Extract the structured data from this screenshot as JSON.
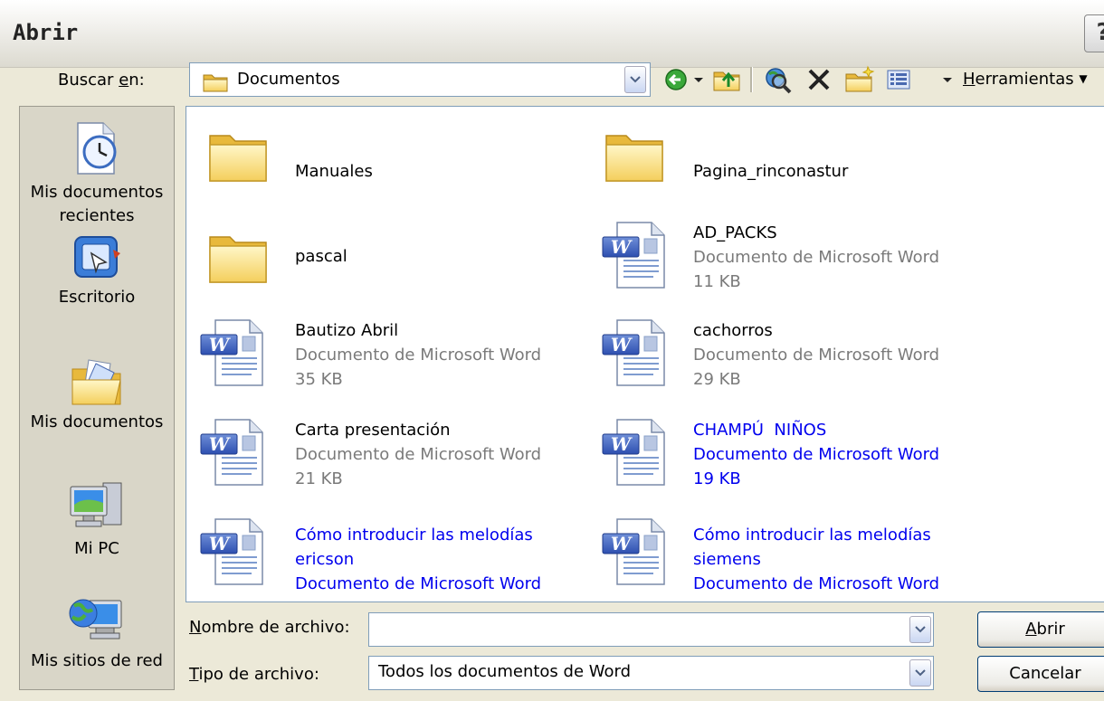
{
  "window": {
    "title": "Abrir",
    "help_glyph": "?"
  },
  "toolbar": {
    "lookin_label": "Buscar en:",
    "lookin_label_accel": "e",
    "lookin_value": "Documentos",
    "tools_label": "Herramientas"
  },
  "places": [
    {
      "label": "Mis documentos recientes",
      "icon": "recent-docs-icon"
    },
    {
      "label": "Escritorio",
      "icon": "desktop-icon"
    },
    {
      "label": "Mis documentos",
      "icon": "my-documents-icon"
    },
    {
      "label": "Mi PC",
      "icon": "my-computer-icon"
    },
    {
      "label": "Mis sitios de red",
      "icon": "network-places-icon"
    }
  ],
  "files": [
    {
      "name": "Manuales",
      "type": "",
      "size": "",
      "icon": "folder-icon",
      "selected": false
    },
    {
      "name": "Pagina_rinconastur",
      "type": "",
      "size": "",
      "icon": "folder-icon",
      "selected": false
    },
    {
      "name": "pascal",
      "type": "",
      "size": "",
      "icon": "folder-icon",
      "selected": false
    },
    {
      "name": "AD_PACKS",
      "type": "Documento de Microsoft Word",
      "size": "11 KB",
      "icon": "word-doc-icon",
      "selected": false
    },
    {
      "name": "Bautizo Abril",
      "type": "Documento de Microsoft Word",
      "size": "35 KB",
      "icon": "word-doc-icon",
      "selected": false
    },
    {
      "name": "cachorros",
      "type": "Documento de Microsoft Word",
      "size": "29 KB",
      "icon": "word-doc-icon",
      "selected": false
    },
    {
      "name": "Carta presentación",
      "type": "Documento de Microsoft Word",
      "size": "21 KB",
      "icon": "word-doc-icon",
      "selected": false
    },
    {
      "name": "CHAMPÚ  NIÑOS",
      "type": "Documento de Microsoft Word",
      "size": "19 KB",
      "icon": "word-doc-icon",
      "selected": true
    },
    {
      "name": "Cómo introducir las melodías",
      "name2": "ericson",
      "type": "Documento de Microsoft Word",
      "icon": "word-doc-icon",
      "selected": true
    },
    {
      "name": "Cómo introducir las melodías",
      "name2": "siemens",
      "type": "Documento de Microsoft Word",
      "icon": "word-doc-icon",
      "selected": true
    }
  ],
  "bottom": {
    "filename_label_accel": "N",
    "filename_label_rest": "ombre de archivo:",
    "filename_value": "",
    "filetype_label_accel": "T",
    "filetype_label_rest": "ipo de archivo:",
    "filetype_value": "Todos los documentos de Word",
    "open_accel": "A",
    "open_rest": "brir",
    "cancel_label": "Cancelar"
  },
  "colors": {
    "selection_text": "#0000ee",
    "dialog_bg": "#ece9d8",
    "field_border": "#7f9db9"
  }
}
